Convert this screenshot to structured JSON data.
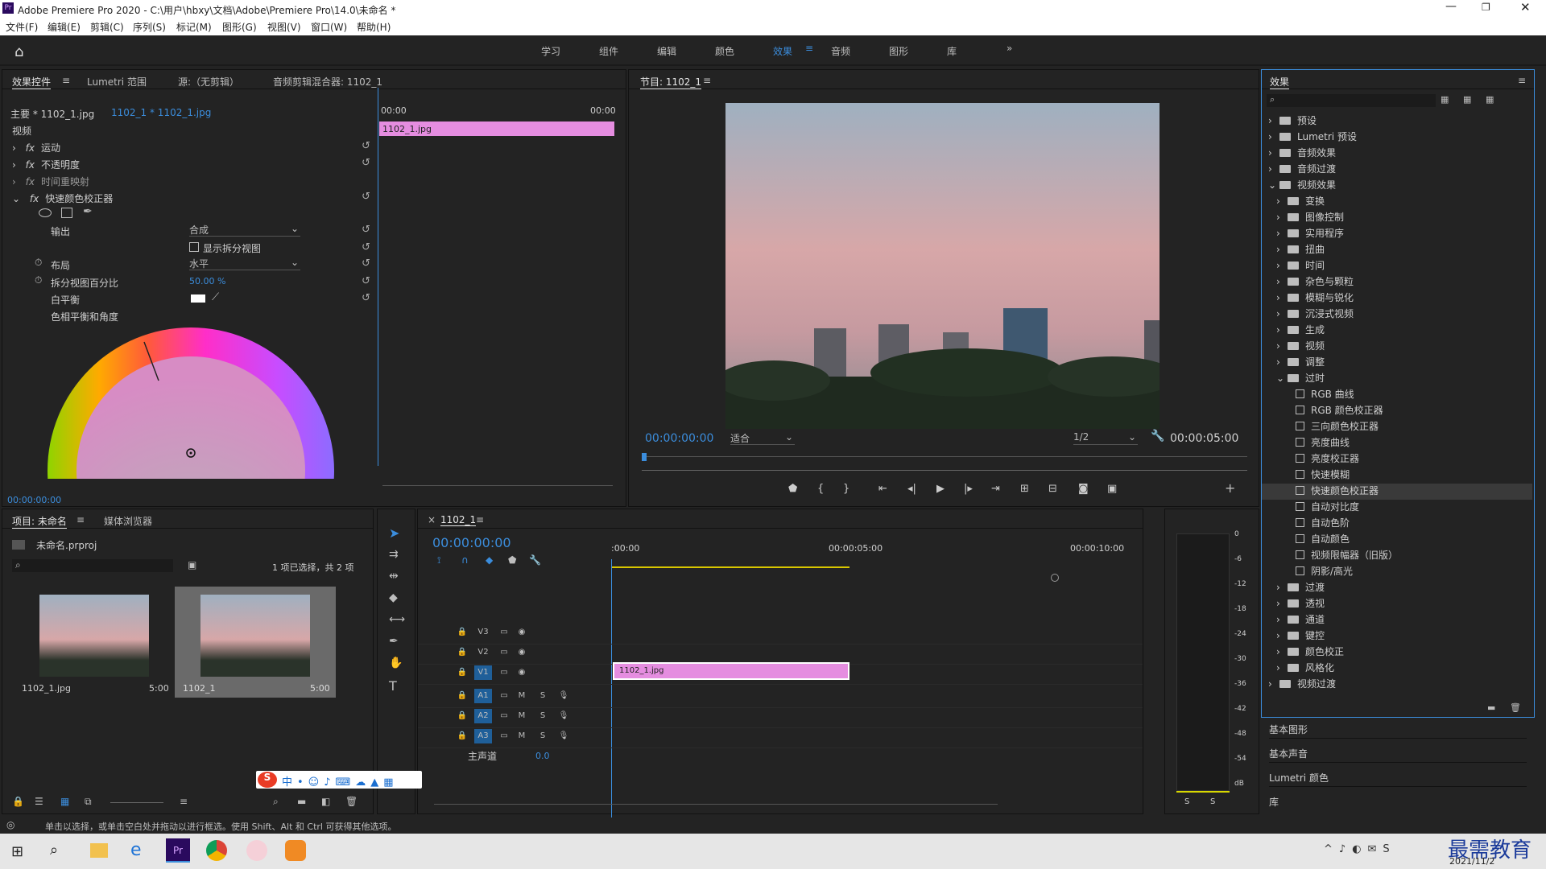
{
  "title": {
    "app": "Adobe Premiere Pro 2020 - C:\\用户\\hbxy\\文档\\Adobe\\Premiere Pro\\14.0\\未命名 *"
  },
  "menu": [
    "文件(F)",
    "编辑(E)",
    "剪辑(C)",
    "序列(S)",
    "标记(M)",
    "图形(G)",
    "视图(V)",
    "窗口(W)",
    "帮助(H)"
  ],
  "workspaces": [
    "学习",
    "组件",
    "编辑",
    "颜色",
    "效果",
    "音频",
    "图形",
    "库"
  ],
  "effect_controls": {
    "tabs": [
      "效果控件",
      "Lumetri 范围",
      "源:（无剪辑）",
      "音频剪辑混合器: 1102_1"
    ],
    "master": "主要 * 1102_1.jpg",
    "clip": "1102_1 * 1102_1.jpg",
    "section": "视频",
    "props": [
      "运动",
      "不透明度",
      "时间重映射",
      "快速颜色校正器"
    ],
    "output_label": "输出",
    "output_value": "合成",
    "split_checkbox": "显示拆分视图",
    "layout_label": "布局",
    "layout_value": "水平",
    "split_pct_label": "拆分视图百分比",
    "split_pct_value": "50.00 %",
    "white_balance": "白平衡",
    "hue_label": "色相平衡和角度",
    "time0": "00:00",
    "time1": "00:00",
    "clip_name": "1102_1.jpg",
    "timecode": "00:00:00:00"
  },
  "program": {
    "title": "节目: 1102_1",
    "timecode": "00:00:00:00",
    "fit": "适合",
    "quality": "1/2",
    "duration": "00:00:05:00"
  },
  "effects": {
    "title": "效果",
    "tree": [
      {
        "label": "预设",
        "level": 0,
        "type": "folder"
      },
      {
        "label": "Lumetri 预设",
        "level": 0,
        "type": "folder"
      },
      {
        "label": "音频效果",
        "level": 0,
        "type": "folder"
      },
      {
        "label": "音频过渡",
        "level": 0,
        "type": "folder"
      },
      {
        "label": "视频效果",
        "level": 0,
        "type": "folder",
        "open": true
      },
      {
        "label": "变换",
        "level": 1,
        "type": "folder"
      },
      {
        "label": "图像控制",
        "level": 1,
        "type": "folder"
      },
      {
        "label": "实用程序",
        "level": 1,
        "type": "folder"
      },
      {
        "label": "扭曲",
        "level": 1,
        "type": "folder"
      },
      {
        "label": "时间",
        "level": 1,
        "type": "folder"
      },
      {
        "label": "杂色与颗粒",
        "level": 1,
        "type": "folder"
      },
      {
        "label": "模糊与锐化",
        "level": 1,
        "type": "folder"
      },
      {
        "label": "沉浸式视频",
        "level": 1,
        "type": "folder"
      },
      {
        "label": "生成",
        "level": 1,
        "type": "folder"
      },
      {
        "label": "视频",
        "level": 1,
        "type": "folder"
      },
      {
        "label": "调整",
        "level": 1,
        "type": "folder"
      },
      {
        "label": "过时",
        "level": 1,
        "type": "folder",
        "open": true
      },
      {
        "label": "RGB 曲线",
        "level": 2,
        "type": "fx"
      },
      {
        "label": "RGB 颜色校正器",
        "level": 2,
        "type": "fx"
      },
      {
        "label": "三向颜色校正器",
        "level": 2,
        "type": "fx"
      },
      {
        "label": "亮度曲线",
        "level": 2,
        "type": "fx"
      },
      {
        "label": "亮度校正器",
        "level": 2,
        "type": "fx"
      },
      {
        "label": "快速模糊",
        "level": 2,
        "type": "fx"
      },
      {
        "label": "快速颜色校正器",
        "level": 2,
        "type": "fx",
        "selected": true
      },
      {
        "label": "自动对比度",
        "level": 2,
        "type": "fx"
      },
      {
        "label": "自动色阶",
        "level": 2,
        "type": "fx"
      },
      {
        "label": "自动颜色",
        "level": 2,
        "type": "fx"
      },
      {
        "label": "视频限幅器（旧版）",
        "level": 2,
        "type": "fx"
      },
      {
        "label": "阴影/高光",
        "level": 2,
        "type": "fx"
      },
      {
        "label": "过渡",
        "level": 1,
        "type": "folder"
      },
      {
        "label": "透视",
        "level": 1,
        "type": "folder"
      },
      {
        "label": "通道",
        "level": 1,
        "type": "folder"
      },
      {
        "label": "键控",
        "level": 1,
        "type": "folder"
      },
      {
        "label": "颜色校正",
        "level": 1,
        "type": "folder"
      },
      {
        "label": "风格化",
        "level": 1,
        "type": "folder"
      },
      {
        "label": "视频过渡",
        "level": 0,
        "type": "folder"
      }
    ],
    "sections": [
      "基本图形",
      "基本声音",
      "Lumetri 颜色",
      "库"
    ]
  },
  "project": {
    "tabs": [
      "项目: 未命名",
      "媒体浏览器"
    ],
    "file": "未命名.prproj",
    "selection": "1 项已选择，共 2 项",
    "items": [
      {
        "name": "1102_1.jpg",
        "dur": "5:00"
      },
      {
        "name": "1102_1",
        "dur": "5:00"
      }
    ]
  },
  "timeline": {
    "tab": "1102_1",
    "timecode": "00:00:00:00",
    "ruler": [
      ":00:00",
      "00:00:05:00",
      "00:00:10:00"
    ],
    "tracks": [
      "V3",
      "V2",
      "V1",
      "A1",
      "A2",
      "A3"
    ],
    "master": "主声道",
    "master_val": "0.0",
    "clip": "1102_1.jpg"
  },
  "meter": {
    "db": [
      "0",
      "-6",
      "-12",
      "-18",
      "-24",
      "-30",
      "-36",
      "-42",
      "-48",
      "-54",
      "dB"
    ],
    "solo": [
      "S",
      "S"
    ]
  },
  "status": "单击以选择，或单击空白处并拖动以进行框选。使用 Shift、Alt 和 Ctrl 可获得其他选项。",
  "taskbar": {
    "date": "2021/11/2",
    "watermark": "最需教育"
  }
}
